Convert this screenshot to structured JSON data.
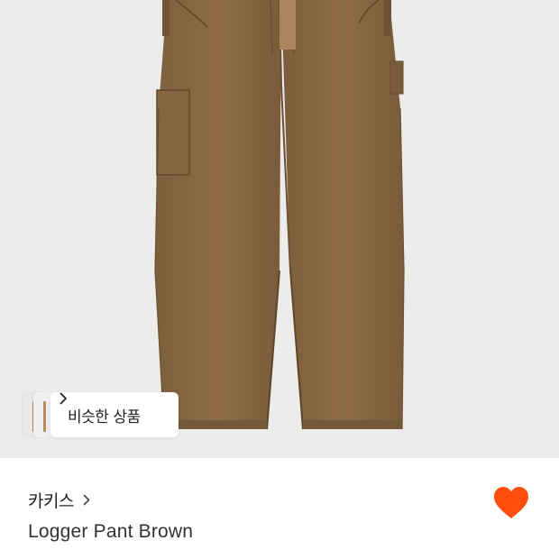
{
  "similar": {
    "label": "비슷한 상품"
  },
  "product": {
    "brand": "카키스",
    "name": "Logger Pant Brown",
    "liked": true
  },
  "colors": {
    "accent": "#ff4e0d",
    "pant": "#8a6a45"
  },
  "icons": {
    "similar_chevron": "chevron-right-icon",
    "brand_chevron": "chevron-right-icon",
    "like": "heart-icon"
  }
}
